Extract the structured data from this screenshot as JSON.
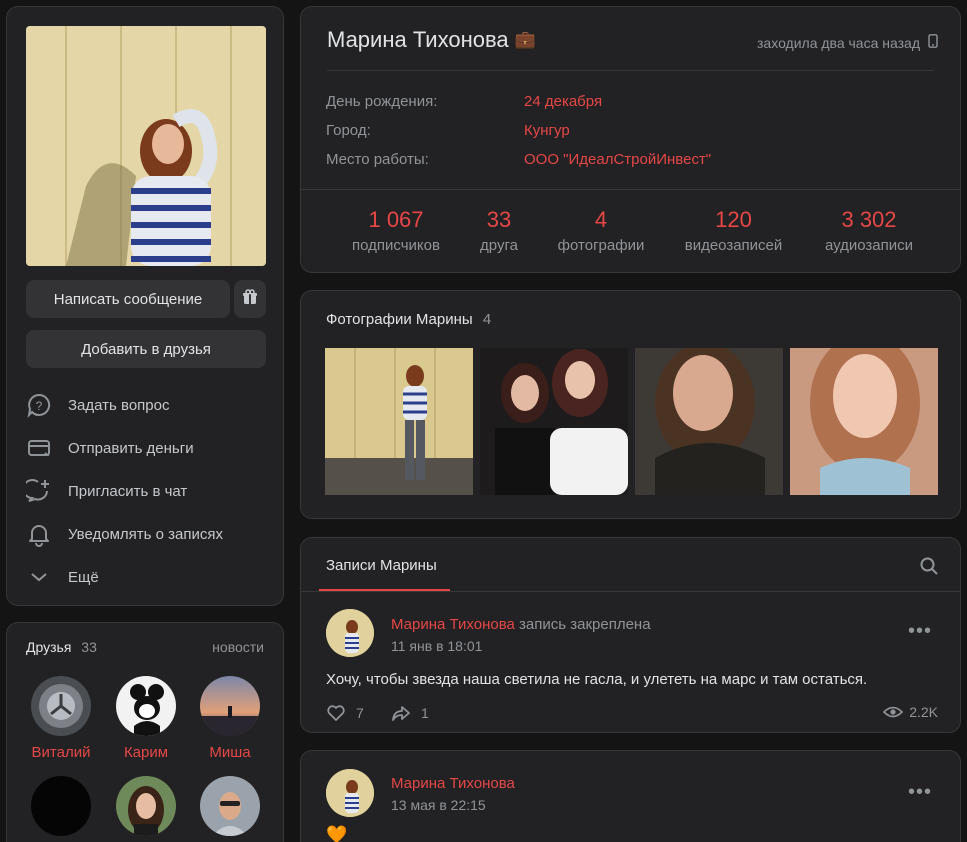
{
  "profile": {
    "name": "Марина Тихонова",
    "status_badge": "💼",
    "last_seen": "заходила два часа назад",
    "info": [
      {
        "label": "День рождения:",
        "value": "24 декабря"
      },
      {
        "label": "Город:",
        "value": "Кунгур"
      },
      {
        "label": "Место работы:",
        "value": "ООО \"ИдеалСтройИнвест\""
      }
    ],
    "counters": [
      {
        "num": "1 067",
        "label": "подписчиков"
      },
      {
        "num": "33",
        "label": "друга"
      },
      {
        "num": "4",
        "label": "фотографии"
      },
      {
        "num": "120",
        "label": "видеозаписей"
      },
      {
        "num": "3 302",
        "label": "аудиозаписи"
      }
    ]
  },
  "actions": {
    "message_button": "Написать сообщение",
    "add_friend_button": "Добавить в друзья",
    "items": [
      {
        "label": "Задать вопрос",
        "icon": "question-bubble-icon"
      },
      {
        "label": "Отправить деньги",
        "icon": "money-card-icon"
      },
      {
        "label": "Пригласить в чат",
        "icon": "chat-add-icon"
      },
      {
        "label": "Уведомлять о записях",
        "icon": "bell-icon"
      },
      {
        "label": "Ещё",
        "icon": "chevron-down-icon"
      }
    ]
  },
  "friends": {
    "title": "Друзья",
    "count": "33",
    "news_link": "новости",
    "list": [
      {
        "name": "Виталий"
      },
      {
        "name": "Карим"
      },
      {
        "name": "Миша"
      },
      {
        "name": ""
      },
      {
        "name": ""
      },
      {
        "name": ""
      }
    ]
  },
  "photos": {
    "title": "Фотографии Марины",
    "count": "4"
  },
  "wall": {
    "tab": "Записи Марины",
    "posts": [
      {
        "author": "Марина Тихонова",
        "action": "запись закреплена",
        "time": "11 янв в 18:01",
        "text": "Хочу, чтобы звезда наша светила не гасла, и улететь на марс и там остаться.",
        "likes": "7",
        "shares": "1",
        "views": "2.2K"
      },
      {
        "author": "Марина Тихонова",
        "time": "13 мая в 22:15",
        "text": "🧡"
      }
    ]
  },
  "colors": {
    "accent": "#e64646",
    "background": "#141414",
    "card": "#222224"
  }
}
